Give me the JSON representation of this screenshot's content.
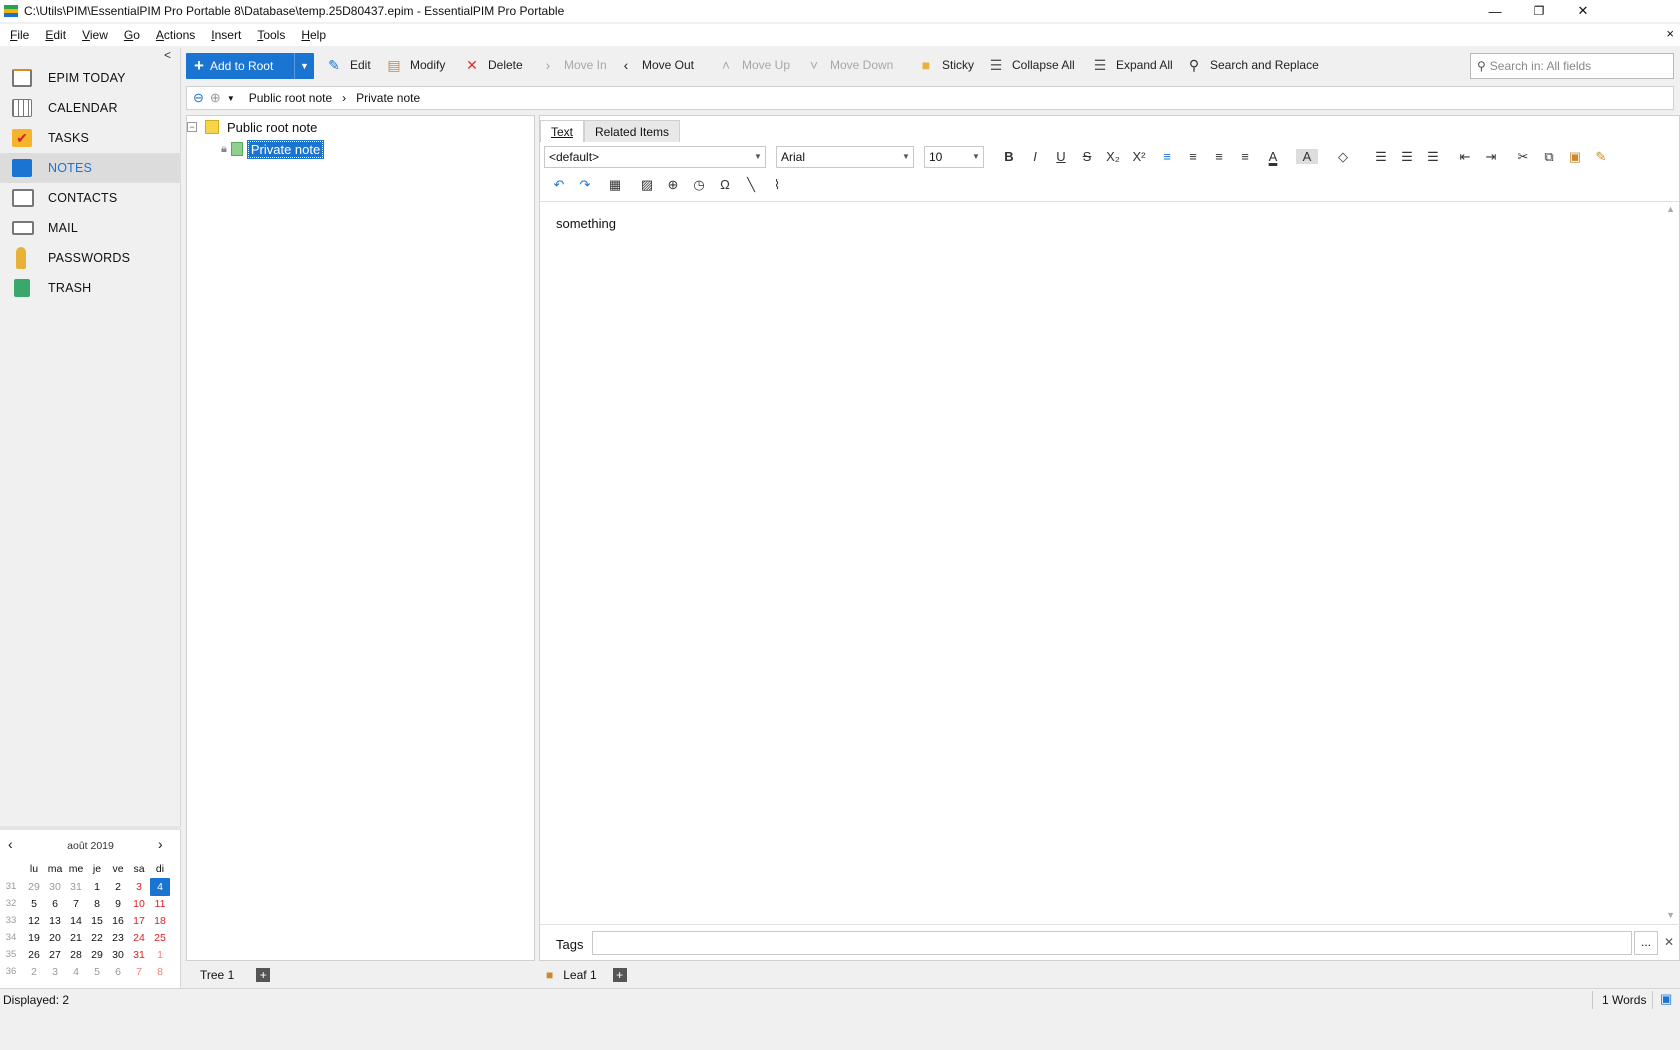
{
  "window": {
    "title": "C:\\Utils\\PIM\\EssentialPIM Pro Portable 8\\Database\\temp.25D80437.epim - EssentialPIM Pro Portable",
    "minimize": "—",
    "restore": "❐",
    "close": "✕"
  },
  "menu": [
    "File",
    "Edit",
    "View",
    "Go",
    "Actions",
    "Insert",
    "Tools",
    "Help"
  ],
  "menu_close": "×",
  "sidebar": {
    "collapse": "<",
    "items": [
      {
        "label": "EPIM TODAY",
        "icon": "home-icon"
      },
      {
        "label": "CALENDAR",
        "icon": "calendar-icon"
      },
      {
        "label": "TASKS",
        "icon": "tasks-icon"
      },
      {
        "label": "NOTES",
        "icon": "notes-icon",
        "active": true
      },
      {
        "label": "CONTACTS",
        "icon": "contacts-icon"
      },
      {
        "label": "MAIL",
        "icon": "mail-icon"
      },
      {
        "label": "PASSWORDS",
        "icon": "key-icon"
      },
      {
        "label": "TRASH",
        "icon": "trash-icon"
      }
    ]
  },
  "toolbar": {
    "add_root": "Add to Root",
    "edit": "Edit",
    "modify": "Modify",
    "delete": "Delete",
    "move_in": "Move In",
    "move_out": "Move Out",
    "move_up": "Move Up",
    "move_down": "Move Down",
    "sticky": "Sticky",
    "collapse_all": "Collapse All",
    "expand_all": "Expand All",
    "search_replace": "Search and Replace",
    "search_placeholder": "Search in: All fields"
  },
  "breadcrumb": {
    "parts": [
      "Public root note",
      "Private note"
    ],
    "sep": "›"
  },
  "tree": {
    "root": "Public root note",
    "child": "Private note",
    "tab": "Tree 1"
  },
  "editor": {
    "tabs": [
      "Text",
      "Related Items"
    ],
    "style": "<default>",
    "font": "Arial",
    "size": "10",
    "content": "something",
    "tags_label": "Tags",
    "tags_more": "...",
    "leaf_tab": "Leaf 1"
  },
  "calendar": {
    "month": "août  2019",
    "weekdays": [
      "lu",
      "ma",
      "me",
      "je",
      "ve",
      "sa",
      "di"
    ],
    "weeks": [
      {
        "wk": "31",
        "days": [
          "29",
          "30",
          "31",
          "1",
          "2",
          "3",
          "4"
        ]
      },
      {
        "wk": "32",
        "days": [
          "5",
          "6",
          "7",
          "8",
          "9",
          "10",
          "11"
        ]
      },
      {
        "wk": "33",
        "days": [
          "12",
          "13",
          "14",
          "15",
          "16",
          "17",
          "18"
        ]
      },
      {
        "wk": "34",
        "days": [
          "19",
          "20",
          "21",
          "22",
          "23",
          "24",
          "25"
        ]
      },
      {
        "wk": "35",
        "days": [
          "26",
          "27",
          "28",
          "29",
          "30",
          "31",
          "1"
        ]
      },
      {
        "wk": "36",
        "days": [
          "2",
          "3",
          "4",
          "5",
          "6",
          "7",
          "8"
        ]
      }
    ],
    "today": "4"
  },
  "status": {
    "displayed": "Displayed: 2",
    "words": "1 Words"
  },
  "colors": {
    "accent": "#1a74d2",
    "weekend": "#e02020"
  }
}
